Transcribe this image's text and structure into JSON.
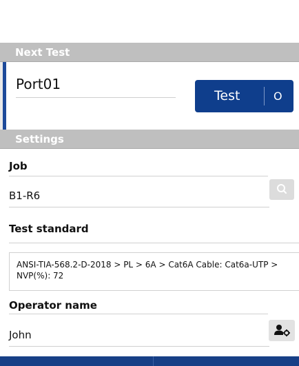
{
  "next_test": {
    "header": "Next Test",
    "port_name": "Port01",
    "test_button_label": "Test",
    "test_button_indicator": "O"
  },
  "settings": {
    "header": "Settings",
    "job_label": "Job",
    "job_value": "B1-R6",
    "test_standard_label": "Test standard",
    "test_standard_value": "ANSI-TIA-568.2-D-2018 > PL > 6A > Cat6A Cable: Cat6a-UTP > NVP(%): 72",
    "operator_label": "Operator name",
    "operator_value": "John"
  },
  "icons": {
    "job_search": "search-icon",
    "operator": "user-settings-icon"
  },
  "colors": {
    "accent": "#0f3e8c",
    "section_header": "#bfbfbf"
  }
}
